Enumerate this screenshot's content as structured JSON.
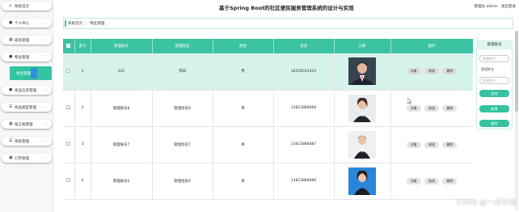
{
  "header": {
    "title": "基于Spring Boot的社区便民服务管理系统的设计与实现",
    "user_label": "管理员 admin",
    "logout_label": "退出登录"
  },
  "sidebar": {
    "items": [
      {
        "label": "系统首页",
        "icon": "home-icon"
      },
      {
        "label": "个人中心",
        "icon": "person-icon"
      },
      {
        "label": "居民管理",
        "icon": "grid-icon"
      },
      {
        "label": "物业管理",
        "icon": "person-icon"
      },
      {
        "label": "商品信息管理",
        "icon": "person-icon"
      },
      {
        "label": "商品类型管理",
        "icon": "list-icon"
      },
      {
        "label": "留言板管理",
        "icon": "grid-icon"
      },
      {
        "label": "系统管理",
        "icon": "list-icon"
      },
      {
        "label": "订单管理",
        "icon": "cart-icon"
      }
    ],
    "submenu_label": "物业管理"
  },
  "breadcrumb": {
    "home": "系统首页",
    "separator": "|",
    "current": "物业管理"
  },
  "table": {
    "columns": [
      "",
      "索引",
      "管理账号",
      "管理姓名",
      "性别",
      "电话",
      "头像",
      "操作"
    ],
    "rows": [
      {
        "index": "1",
        "account": "222",
        "name": "李四",
        "gender": "男",
        "phone": "18156541454"
      },
      {
        "index": "2",
        "account": "管理账号8",
        "name": "管理姓名8",
        "gender": "男",
        "phone": "13823888888"
      },
      {
        "index": "3",
        "account": "管理账号7",
        "name": "管理姓名7",
        "gender": "男",
        "phone": "13823888887"
      },
      {
        "index": "4",
        "account": "管理账号6",
        "name": "管理姓名6",
        "gender": "男",
        "phone": "13823888886"
      }
    ],
    "actions": {
      "detail": "详情",
      "edit": "修改",
      "delete": "删除"
    }
  },
  "search_panel": {
    "title": "管理账号",
    "account_placeholder": "管理账号",
    "name_label": "管理姓名",
    "name_placeholder": "管理姓名",
    "search_button": "查询",
    "add_button": "新增",
    "delete_button": "删除"
  },
  "watermark": "CSDN @一点毕设",
  "colors": {
    "accent": "#35c3a2",
    "header_row": "#3cc3a1",
    "selected_row": "#d6f4ec"
  }
}
